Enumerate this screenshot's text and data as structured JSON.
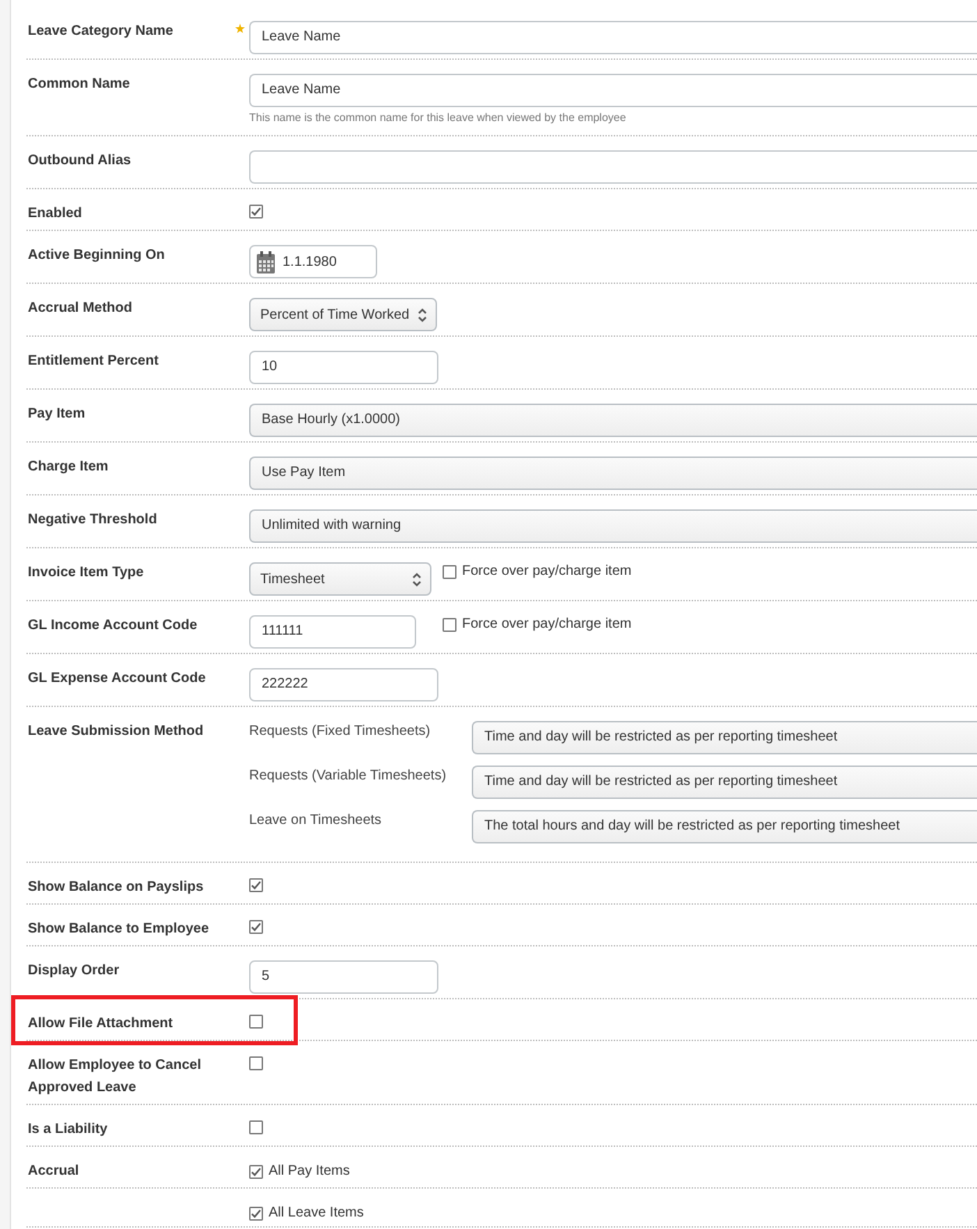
{
  "form": {
    "rows": [
      {
        "kind": "text",
        "label": "Leave Category Name",
        "required": true,
        "value": "Leave Name"
      },
      {
        "kind": "text",
        "label": "Common Name",
        "value": "Leave Name",
        "help": "This name is the common name for this leave when viewed by the employee"
      },
      {
        "kind": "text",
        "label": "Outbound Alias"
      },
      {
        "kind": "checkbox",
        "label": "Enabled",
        "checked": true
      },
      {
        "kind": "date",
        "label": "Active Beginning On",
        "value": "1.1.1980"
      },
      {
        "kind": "spinner",
        "label": "Accrual Method",
        "value": "Percent of Time Worked"
      },
      {
        "kind": "short",
        "label": "Entitlement Percent",
        "value": "10"
      },
      {
        "kind": "select",
        "label": "Pay Item",
        "value": "Base Hourly (x1.0000)"
      },
      {
        "kind": "select",
        "label": "Charge Item",
        "value": "Use Pay Item"
      },
      {
        "kind": "select",
        "label": "Negative Threshold",
        "value": "Unlimited with warning"
      },
      {
        "kind": "spinner",
        "label": "Invoice Item Type",
        "value": "Timesheet",
        "option": {
          "label": "Force over pay/charge item",
          "checked": false
        }
      },
      {
        "kind": "short",
        "label": "GL Income Account Code",
        "value": "111111",
        "option": {
          "label": "Force over pay/charge item",
          "checked": false
        }
      },
      {
        "kind": "short",
        "label": "GL Expense Account Code",
        "value": "222222"
      },
      {
        "kind": "submission",
        "label": "Leave Submission Method",
        "methods": [
          {
            "label": "Requests (Fixed Timesheets)",
            "value": "Time and day will be restricted as per reporting timesheet"
          },
          {
            "label": "Requests (Variable Timesheets)",
            "value": "Time and day will be restricted as per reporting timesheet"
          },
          {
            "label": "Leave on Timesheets",
            "value": "The total hours and day will be restricted as per reporting timesheet"
          }
        ]
      },
      {
        "kind": "checkbox",
        "label": "Show Balance on Payslips",
        "checked": true
      },
      {
        "kind": "checkbox",
        "label": "Show Balance to Employee",
        "checked": true
      },
      {
        "kind": "short",
        "label": "Display Order",
        "value": "5"
      },
      {
        "kind": "checkbox",
        "label": "Allow File Attachment",
        "highlighted": true,
        "checked": false
      },
      {
        "kind": "checkbox",
        "label": "Allow Employee to Cancel Approved Leave",
        "checked": false
      },
      {
        "kind": "checkbox",
        "label": "Is a Liability",
        "checked": false
      },
      {
        "kind": "checklist",
        "label": "Accrual",
        "options": [
          {
            "label": "All Pay Items",
            "checked": true
          },
          {
            "label": "All Leave Items",
            "checked": true
          }
        ]
      }
    ]
  }
}
